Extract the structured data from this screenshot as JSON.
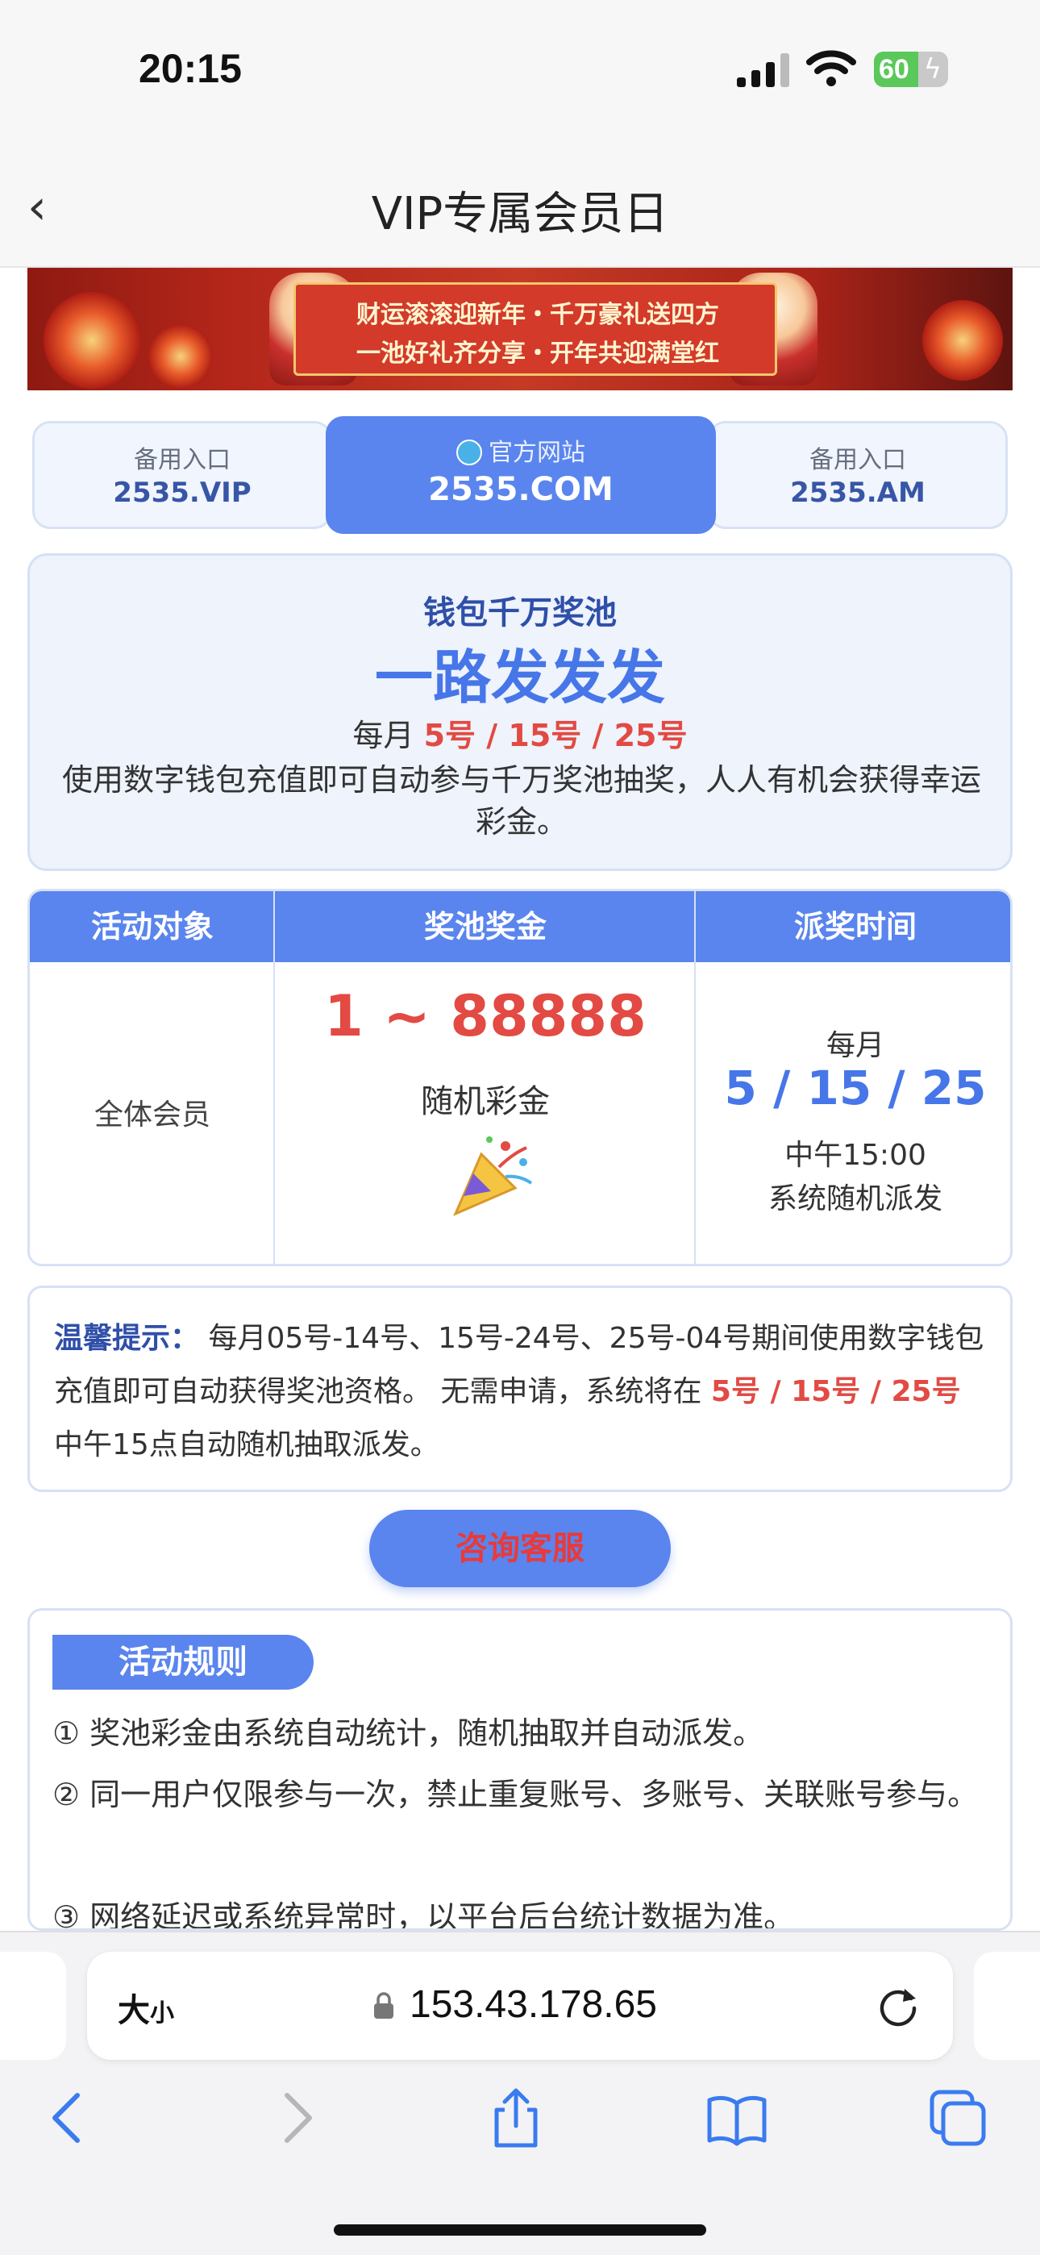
{
  "status_bar": {
    "time": "20:15",
    "battery": "60",
    "battery_level": 0.6
  },
  "nav": {
    "title": "VIP专属会员日"
  },
  "banner": {
    "line1": "财运滚滚迎新年・千万豪礼送四方",
    "line2": "一池好礼齐分享・开年共迎满堂红"
  },
  "entries": [
    {
      "label": "备用入口",
      "url": "2535.VIP"
    },
    {
      "label": "官方网站",
      "url": "2535.COM"
    },
    {
      "label": "备用入口",
      "url": "2535.AM"
    }
  ],
  "jackpot": {
    "title": "钱包千万奖池",
    "slogan": "一路发发发",
    "date_prefix": "每月 ",
    "dates": "5号 / 15号 / 25号",
    "description": "使用数字钱包充值即可自动参与千万奖池抽奖，人人有机会获得幸运彩金。"
  },
  "table": {
    "headers": [
      "活动对象",
      "奖池奖金",
      "派奖时间"
    ],
    "target": "全体会员",
    "prize_range": "1 ~ 88888",
    "prize_label": "随机彩金",
    "time_monthly": "每月",
    "time_days": "5 / 15 / 25",
    "time_noon": "中午15:00",
    "time_method": "系统随机派发"
  },
  "tip": {
    "label": "温馨提示：",
    "text1": " 每月05号-14号、15号-24号、25号-04号期间使用数字钱包充值即可自动获得奖池资格。 无需申请，系统将在 ",
    "red": "5号 / 15号 / 25号",
    "text2": " 中午15点自动随机抽取派发。"
  },
  "consult_button": "咨询客服",
  "rules": {
    "title": "活动规则",
    "items": [
      "① 奖池彩金由系统自动统计，随机抽取并自动派发。",
      "② 同一用户仅限参与一次，禁止重复账号、多账号、关联账号参与。",
      "③ 网络延迟或系统异常时，以平台后台统计数据为准。"
    ]
  },
  "browser": {
    "aa_big": "大",
    "aa_small": "小",
    "url": "153.43.178.65"
  },
  "colors": {
    "accent": "#5a85ee",
    "red": "#e24a43",
    "navy": "#2f4fa8"
  }
}
